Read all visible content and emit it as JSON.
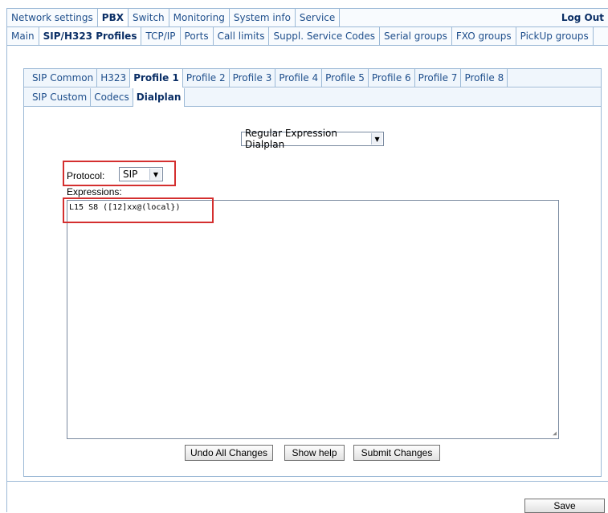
{
  "nav1": {
    "tabs": [
      "Network settings",
      "PBX",
      "Switch",
      "Monitoring",
      "System info",
      "Service"
    ],
    "active": "PBX",
    "logout": "Log Out"
  },
  "nav2": {
    "tabs": [
      "Main",
      "SIP/H323 Profiles",
      "TCP/IP",
      "Ports",
      "Call limits",
      "Suppl. Service Codes",
      "Serial groups",
      "FXO groups",
      "PickUp groups"
    ],
    "active": "SIP/H323 Profiles"
  },
  "profile_tabs": {
    "tabs": [
      "SIP Common",
      "H323",
      "Profile 1",
      "Profile 2",
      "Profile 3",
      "Profile 4",
      "Profile 5",
      "Profile 6",
      "Profile 7",
      "Profile 8"
    ],
    "active": "Profile 1"
  },
  "sub_tabs": {
    "tabs": [
      "SIP Custom",
      "Codecs",
      "Dialplan"
    ],
    "active": "Dialplan"
  },
  "dialplan_type": "Regular Expression Dialplan",
  "protocol": {
    "label": "Protocol:",
    "value": "SIP"
  },
  "expressions": {
    "label": "Expressions:",
    "value": "L15 S8 ([12]xx@(local})"
  },
  "buttons": {
    "undo": "Undo All Changes",
    "help": "Show help",
    "submit": "Submit Changes",
    "save": "Save"
  },
  "colors": {
    "highlight": "#d42f2f",
    "border": "#9cb9d6"
  }
}
